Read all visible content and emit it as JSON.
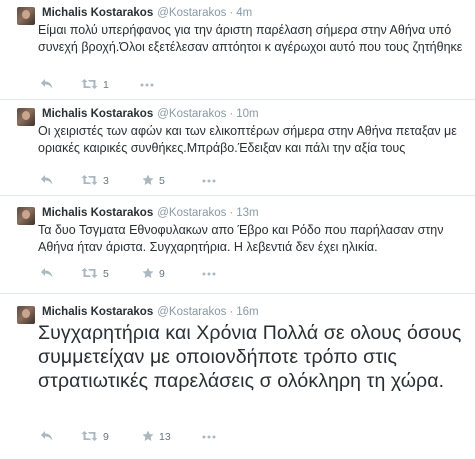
{
  "tweets": [
    {
      "fullname": "Michalis Kostarakos",
      "username": "@Kostarakos",
      "separator": "·",
      "time": "4m",
      "text": "Είμαι πολύ υπερήφανος για την άριστη παρέλαση σήμερα στην Αθήνα υπό συνεχή βροχή.Όλοι εξετέλεσαν απτόητοι κ αγέρωχοι αυτό που τους ζητήθηκε",
      "retweets": "1",
      "favorites": ""
    },
    {
      "fullname": "Michalis Kostarakos",
      "username": "@Kostarakos",
      "separator": "·",
      "time": "10m",
      "text": "Οι χειριστές των αφών και των ελικοπτέρων σήμερα στην Αθήνα πεταξαν με οριακές καιρικές συνθήκες.Μπράβο.Έδειξαν και πάλι την αξία τους",
      "retweets": "3",
      "favorites": "5"
    },
    {
      "fullname": "Michalis Kostarakos",
      "username": "@Kostarakos",
      "separator": "·",
      "time": "13m",
      "text": "Τα δυο Τσγματα Εθνοφυλακων απο Έβρο και Ρόδο που παρήλασαν στην Αθήνα ήταν άριστα. Συγχαρητήρια. Η λεβεντιά δεν έχει ηλικία.",
      "retweets": "5",
      "favorites": "9"
    },
    {
      "fullname": "Michalis Kostarakos",
      "username": "@Kostarakos",
      "separator": "·",
      "time": "16m",
      "text": "Συγχαρητήρια και Χρόνια Πολλά σε ολους όσους συμμετείχαν με οποιονδήποτε τρόπο στις στρατιωτικές παρελάσεις σ ολόκληρη τη χώρα.",
      "retweets": "9",
      "favorites": "13"
    }
  ],
  "icons": {
    "reply": "reply-icon",
    "retweet": "retweet-icon",
    "favorite": "star-icon",
    "more": "more-dots-icon"
  },
  "colors": {
    "text": "#292f33",
    "muted": "#8899a6",
    "icon": "#aab8c2",
    "divider": "#e1e8ed"
  }
}
